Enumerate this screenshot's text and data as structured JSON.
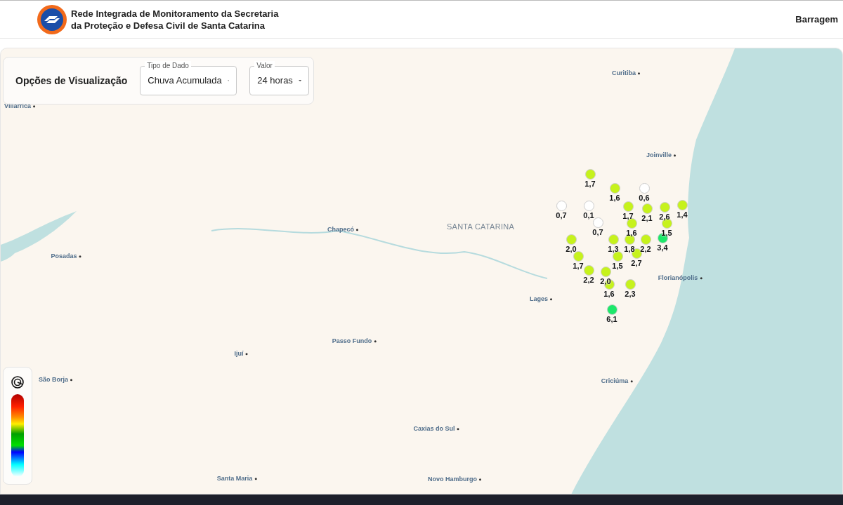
{
  "header": {
    "title_lines": [
      "Rede Integrada de Monitoramento da Secretaria",
      "da Proteção e Defesa Civil de Santa Catarina"
    ],
    "nav_link": "Barragem"
  },
  "options": {
    "title": "Opções de Visualização",
    "selects": [
      {
        "label": "Tipo de Dado",
        "value": "Chuva Acumulada"
      },
      {
        "label": "Valor",
        "value": "24 horas"
      }
    ]
  },
  "map": {
    "places": [
      {
        "name": "Curitiba",
        "kind": "city"
      },
      {
        "name": "Villarrica",
        "kind": "city"
      },
      {
        "name": "Joinville",
        "kind": "city"
      },
      {
        "name": "Chapecó",
        "kind": "city"
      },
      {
        "name": "SANTA CATARINA",
        "kind": "state"
      },
      {
        "name": "Posadas",
        "kind": "city"
      },
      {
        "name": "Florianópolis",
        "kind": "city"
      },
      {
        "name": "Lages",
        "kind": "city"
      },
      {
        "name": "Passo Fundo",
        "kind": "city"
      },
      {
        "name": "Ijuí",
        "kind": "city"
      },
      {
        "name": "São Borja",
        "kind": "city"
      },
      {
        "name": "Criciúma",
        "kind": "city"
      },
      {
        "name": "Caxias do Sul",
        "kind": "city"
      },
      {
        "name": "Santa Maria",
        "kind": "city"
      },
      {
        "name": "Novo Hamburgo",
        "kind": "city"
      }
    ],
    "stations": [
      {
        "value": "1,7",
        "color": "#c6f21c"
      },
      {
        "value": "1,6",
        "color": "#c6f21c"
      },
      {
        "value": "0,6",
        "color": "#ffffff"
      },
      {
        "value": "0,7",
        "color": "#ffffff"
      },
      {
        "value": "0,1",
        "color": "#ffffff"
      },
      {
        "value": "1,7",
        "color": "#c6f21c"
      },
      {
        "value": "2,1",
        "color": "#c6f21c"
      },
      {
        "value": "2,6",
        "color": "#c6f21c"
      },
      {
        "value": "1,4",
        "color": "#c6f21c"
      },
      {
        "value": "0,7",
        "color": "#ffffff"
      },
      {
        "value": "1,6",
        "color": "#c6f21c"
      },
      {
        "value": "1,5",
        "color": "#c6f21c"
      },
      {
        "value": "2,0",
        "color": "#c6f21c"
      },
      {
        "value": "1,3",
        "color": "#c6f21c"
      },
      {
        "value": "1,8",
        "color": "#c6f21c"
      },
      {
        "value": "2,2",
        "color": "#c6f21c"
      },
      {
        "value": "3,4",
        "color": "#1de86a"
      },
      {
        "value": "1,7",
        "color": "#c6f21c"
      },
      {
        "value": "1,5",
        "color": "#c6f21c"
      },
      {
        "value": "2,7",
        "color": "#c6f21c"
      },
      {
        "value": "2,2",
        "color": "#c6f21c"
      },
      {
        "value": "2,0",
        "color": "#c6f21c"
      },
      {
        "value": "1,6",
        "color": "#c6f21c"
      },
      {
        "value": "2,3",
        "color": "#c6f21c"
      },
      {
        "value": "6,1",
        "color": "#1de86a"
      }
    ]
  }
}
